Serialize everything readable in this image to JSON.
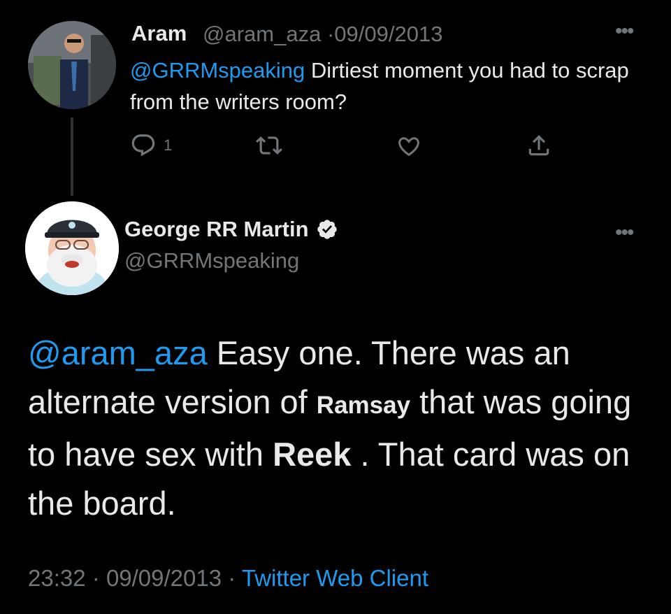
{
  "reply_tweet": {
    "display_name": "Aram",
    "handle": "@aram_aza",
    "separator": "·",
    "date": "09/09/2013",
    "mention": "@GRRMspeaking",
    "text": " Dirtiest moment you had to scrap from the writers room?",
    "reply_count": "1",
    "more_icon": "more-dots-icon",
    "actions": [
      "reply-icon",
      "retweet-icon",
      "like-icon",
      "share-icon"
    ]
  },
  "main_tweet": {
    "display_name": "George RR Martin",
    "verified_icon": "verified-badge-icon",
    "handle": "@GRRMspeaking",
    "mention": "@aram_aza",
    "text_part1": " Easy one.  There was an alternate version of ",
    "bold1": "Ramsay",
    "text_part2": " that was going to have sex with ",
    "bold2": "Reek",
    "text_part3": " .  That card was on the board.",
    "time": "23:32",
    "separator": "·",
    "date": "09/09/2013",
    "client": "Twitter Web Client"
  },
  "colors": {
    "background": "#000000",
    "text": "#e7e9ea",
    "muted": "#71767b",
    "link": "#1d9bf0"
  }
}
